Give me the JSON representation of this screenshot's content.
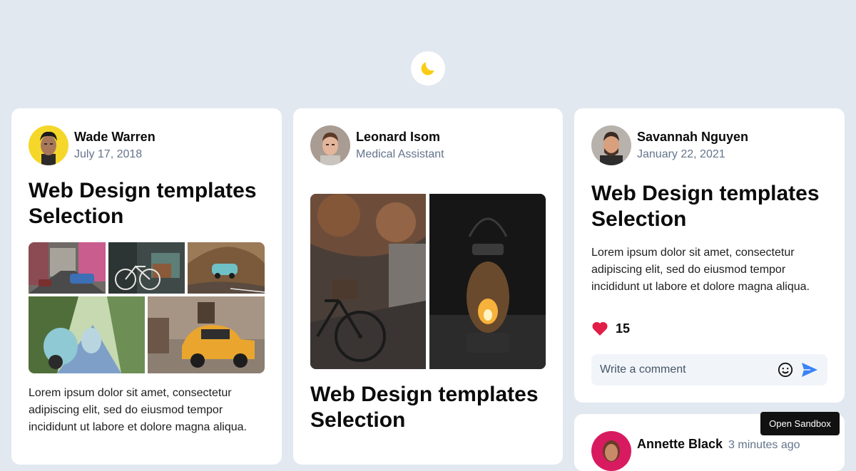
{
  "theme_toggle": {
    "icon": "moon-icon",
    "color": "#facc15"
  },
  "posts": [
    {
      "author": "Wade Warren",
      "meta": "July 17, 2018",
      "title": "Web Design templates Selection",
      "body": "Lorem ipsum dolor sit amet, consectetur adipiscing elit, sed do eiusmod tempor incididunt ut labore et dolore magna aliqua."
    },
    {
      "author": "Leonard Isom",
      "meta": "Medical Assistant",
      "title": "Web Design templates Selection"
    },
    {
      "author": "Savannah Nguyen",
      "meta": "January 22, 2021",
      "title": "Web Design templates Selection",
      "body": "Lorem ipsum dolor sit amet, consectetur adipiscing elit, sed do eiusmod tempor incididunt ut labore et dolore magna aliqua.",
      "likes": "15",
      "comment_placeholder": "Write a comment"
    },
    {
      "author": "Annette Black",
      "meta": "3 minutes ago"
    }
  ],
  "sandbox_button": "Open Sandbox",
  "colors": {
    "background": "#e2e8f0",
    "heart": "#e11d48",
    "send": "#3b82f6"
  }
}
